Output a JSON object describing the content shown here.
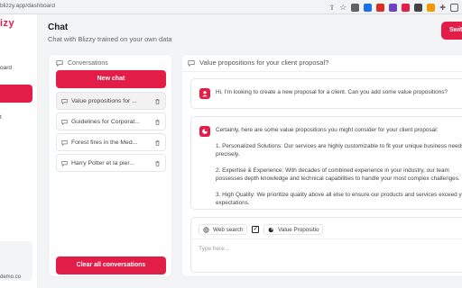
{
  "browser": {
    "url": "blizzy.app/dashboard"
  },
  "sidebar": {
    "logo": "izy",
    "items": [
      {
        "label": "oard"
      },
      {
        "label": "t"
      }
    ],
    "account_email": "demo.co"
  },
  "header": {
    "title": "Chat",
    "subtitle": "Chat with Blizzy trained on your own data",
    "switch_label": "Swit"
  },
  "conversations": {
    "title": "Conversations",
    "new_chat_label": "New chat",
    "items": [
      {
        "label": "Value propositions for ...",
        "active": true
      },
      {
        "label": "Guidelines for Corporat..."
      },
      {
        "label": "Forest fires in the Med..."
      },
      {
        "label": "Harry Potter et la pier..."
      }
    ],
    "clear_label": "Clear all conversations"
  },
  "chat": {
    "title": "Value propositions for your client proposal?",
    "messages": [
      {
        "role": "user",
        "text": "Hi, I'm looking to create a new proposal for a client. Can you add some value propositions?"
      },
      {
        "role": "assistant",
        "text": "Certainly, here are some value propositions you might consider for your client proposal:\n\n1. Personalized Solutions: Our services are highly customizable to fit your unique business needs precisely.\n\n2. Expertise & Experience: With decades of combined experience in your industry, our team possesses depth knowledge and technical capabilities to handle your most complex challenges.\n\n3. High Quality: We prioritize quality above all else to ensure our products and services exceed your expectations."
      }
    ],
    "composer": {
      "web_search_label": "Web search",
      "web_search_checked": true,
      "source_label": "Value Propositio",
      "placeholder": "Type here..."
    }
  },
  "colors": {
    "accent": "#e11d48",
    "background": "#f3f4f6"
  }
}
